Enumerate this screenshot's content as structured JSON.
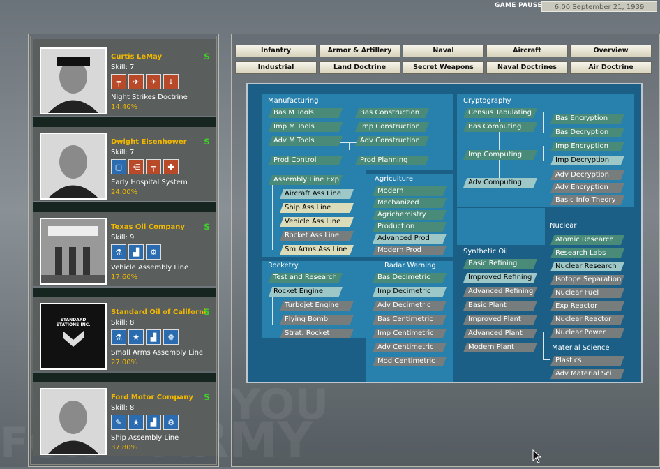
{
  "header": {
    "status": "GAME PAUSED",
    "date": "6:00 September 21, 1939"
  },
  "background": {
    "words": [
      "YOU",
      "ARMY",
      "FOR"
    ]
  },
  "teams": [
    {
      "name": "Curtis LeMay",
      "skill": "Skill: 7",
      "tech": "Night Strikes Doctrine",
      "pct": "14.40%",
      "dollar": "$",
      "photo": "portrait-military",
      "icons": [
        {
          "name": "cannon-icon",
          "g": "╤",
          "c": "red"
        },
        {
          "name": "fighter-plane-icon",
          "g": "✈",
          "c": "red"
        },
        {
          "name": "bomber-plane-icon",
          "g": "✈",
          "c": "red"
        },
        {
          "name": "bomb-icon",
          "g": "↓",
          "c": "red"
        }
      ]
    },
    {
      "name": "Dwight Eisenhower",
      "skill": "Skill: 7",
      "tech": "Early Hospital System",
      "pct": "24.00%",
      "dollar": "$",
      "photo": "portrait-general",
      "icons": [
        {
          "name": "frame-icon",
          "g": "▢",
          "c": "blue"
        },
        {
          "name": "network-icon",
          "g": "⋲",
          "c": "red"
        },
        {
          "name": "cannon-icon",
          "g": "╤",
          "c": "red"
        },
        {
          "name": "medic-icon",
          "g": "✚",
          "c": "red"
        }
      ]
    },
    {
      "name": "Texas Oil Company",
      "skill": "Skill: 9",
      "tech": "Vehicle Assembly Line",
      "pct": "17.60%",
      "dollar": "$",
      "photo": "gas-station",
      "icons": [
        {
          "name": "flask-icon",
          "g": "⚗",
          "c": "blue"
        },
        {
          "name": "factory-icon",
          "g": "▟",
          "c": "blue"
        },
        {
          "name": "gear-icon",
          "g": "⚙",
          "c": "blue"
        }
      ]
    },
    {
      "name": "Standard Oil of Californi",
      "skill": "Skill: 8",
      "tech": "Small Arms Assembly Line",
      "pct": "27.00%",
      "dollar": "$",
      "photo": "standard-logo",
      "logo_text": "STANDARD STATIONS INC.",
      "icons": [
        {
          "name": "flask-icon",
          "g": "⚗",
          "c": "blue"
        },
        {
          "name": "star-icon",
          "g": "★",
          "c": "blue"
        },
        {
          "name": "factory-icon",
          "g": "▟",
          "c": "blue"
        },
        {
          "name": "gear-icon",
          "g": "⚙",
          "c": "blue"
        }
      ]
    },
    {
      "name": "Ford Motor Company",
      "skill": "Skill: 8",
      "tech": "Ship Assembly Line",
      "pct": "37.80%",
      "dollar": "$",
      "photo": "portrait-civilian",
      "icons": [
        {
          "name": "wrench-icon",
          "g": "✎",
          "c": "blue"
        },
        {
          "name": "star-icon",
          "g": "★",
          "c": "blue"
        },
        {
          "name": "factory-icon",
          "g": "▟",
          "c": "blue"
        },
        {
          "name": "gear-icon",
          "g": "⚙",
          "c": "blue"
        }
      ]
    }
  ],
  "tabs_row1": [
    "Infantry",
    "Armor & Artillery",
    "Naval",
    "Aircraft",
    "Overview"
  ],
  "tabs_row2": [
    "Industrial",
    "Land Doctrine",
    "Secret Weapons",
    "Naval Doctrines",
    "Air Doctrine"
  ],
  "tree": {
    "labels": {
      "manufacturing": "Manufacturing",
      "cryptography": "Cryptography",
      "agriculture": "Agriculture",
      "rocketry": "Rocketry",
      "radar": "Radar Warning",
      "synthetic": "Synthetic Oil",
      "nuclear": "Nuclear",
      "material": "Material Science"
    },
    "nodes": [
      {
        "t": "Bas M Tools",
        "s": "r"
      },
      {
        "t": "Imp M Tools",
        "s": "r"
      },
      {
        "t": "Adv M Tools",
        "s": "r"
      },
      {
        "t": "Bas Construction",
        "s": "r"
      },
      {
        "t": "Imp Construction",
        "s": "r"
      },
      {
        "t": "Adv Construction",
        "s": "r"
      },
      {
        "t": "Prod Control",
        "s": "r"
      },
      {
        "t": "Prod Planning",
        "s": "r"
      },
      {
        "t": "Assembly Line Exp",
        "s": "r"
      },
      {
        "t": "Aircraft Ass Line",
        "s": "a"
      },
      {
        "t": "Ship Ass Line",
        "s": "y"
      },
      {
        "t": "Vehicle Ass Line",
        "s": "y"
      },
      {
        "t": "Rocket Ass Line",
        "s": "g"
      },
      {
        "t": "Sm Arms Ass Line",
        "s": "y"
      },
      {
        "t": "Modern",
        "s": "r"
      },
      {
        "t": "Mechanized",
        "s": "r"
      },
      {
        "t": "Agrichemistry",
        "s": "r"
      },
      {
        "t": "Production",
        "s": "r"
      },
      {
        "t": "Advanced Prod",
        "s": "a"
      },
      {
        "t": "Modern Prod",
        "s": "g"
      },
      {
        "t": "Census Tabulating",
        "s": "r"
      },
      {
        "t": "Bas Computing",
        "s": "r"
      },
      {
        "t": "Imp Computing",
        "s": "r"
      },
      {
        "t": "Adv Computing",
        "s": "a"
      },
      {
        "t": "Bas Encryption",
        "s": "r"
      },
      {
        "t": "Bas Decryption",
        "s": "r"
      },
      {
        "t": "Imp Encryption",
        "s": "r"
      },
      {
        "t": "Imp Decryption",
        "s": "a"
      },
      {
        "t": "Adv Decryption",
        "s": "g"
      },
      {
        "t": "Adv Encryption",
        "s": "g"
      },
      {
        "t": "Basic Info Theory",
        "s": "g"
      },
      {
        "t": "Test and Research",
        "s": "r"
      },
      {
        "t": "Rocket Engine",
        "s": "a"
      },
      {
        "t": "Turbojet Engine",
        "s": "g"
      },
      {
        "t": "Flying Bomb",
        "s": "g"
      },
      {
        "t": "Strat. Rocket",
        "s": "g"
      },
      {
        "t": "Bas Decimetric",
        "s": "r"
      },
      {
        "t": "Imp Decimetric",
        "s": "a"
      },
      {
        "t": "Adv Decimetric",
        "s": "g"
      },
      {
        "t": "Bas Centimetric",
        "s": "g"
      },
      {
        "t": "Imp Centimetric",
        "s": "g"
      },
      {
        "t": "Adv Centimetric",
        "s": "g"
      },
      {
        "t": "Mod Centimetric",
        "s": "g"
      },
      {
        "t": "Basic Refining",
        "s": "r"
      },
      {
        "t": "Improved Refining",
        "s": "a"
      },
      {
        "t": "Advanced Refining",
        "s": "g"
      },
      {
        "t": "Basic Plant",
        "s": "g"
      },
      {
        "t": "Improved Plant",
        "s": "g"
      },
      {
        "t": "Advanced Plant",
        "s": "g"
      },
      {
        "t": "Modern Plant",
        "s": "g"
      },
      {
        "t": "Atomic Research",
        "s": "r"
      },
      {
        "t": "Research Labs",
        "s": "r"
      },
      {
        "t": "Nuclear Research",
        "s": "a"
      },
      {
        "t": "Isotope Separation",
        "s": "g"
      },
      {
        "t": "Nuclear Fuel",
        "s": "g"
      },
      {
        "t": "Exp Reactor",
        "s": "g"
      },
      {
        "t": "Nuclear Reactor",
        "s": "g"
      },
      {
        "t": "Nuclear Power",
        "s": "g"
      },
      {
        "t": "Plastics",
        "s": "g"
      },
      {
        "t": "Adv Material Sci",
        "s": "g"
      }
    ]
  }
}
